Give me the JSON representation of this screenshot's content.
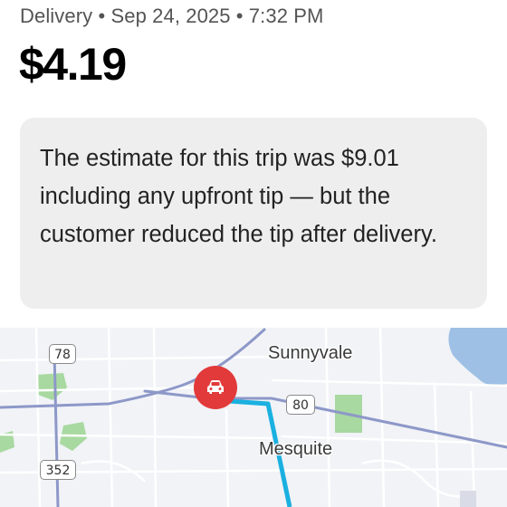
{
  "trip": {
    "meta": "Delivery • Sep 24, 2025 • 7:32 PM",
    "amount": "$4.19",
    "notice": "The estimate for this trip was $9.01 including any upfront tip — but the customer reduced the tip after delivery."
  },
  "map": {
    "labels": {
      "sunnyvale": "Sunnyvale",
      "mesquite": "Mesquite"
    },
    "shields": {
      "route_78": "78",
      "route_80": "80",
      "route_352": "352"
    },
    "icons": {
      "vehicle": "car-icon"
    },
    "colors": {
      "route": "#1ab0e0",
      "vehicle_pin": "#e23a3a",
      "highway": "#8d98c8",
      "water": "#9ec0e4",
      "park": "#a8d9a0"
    }
  }
}
